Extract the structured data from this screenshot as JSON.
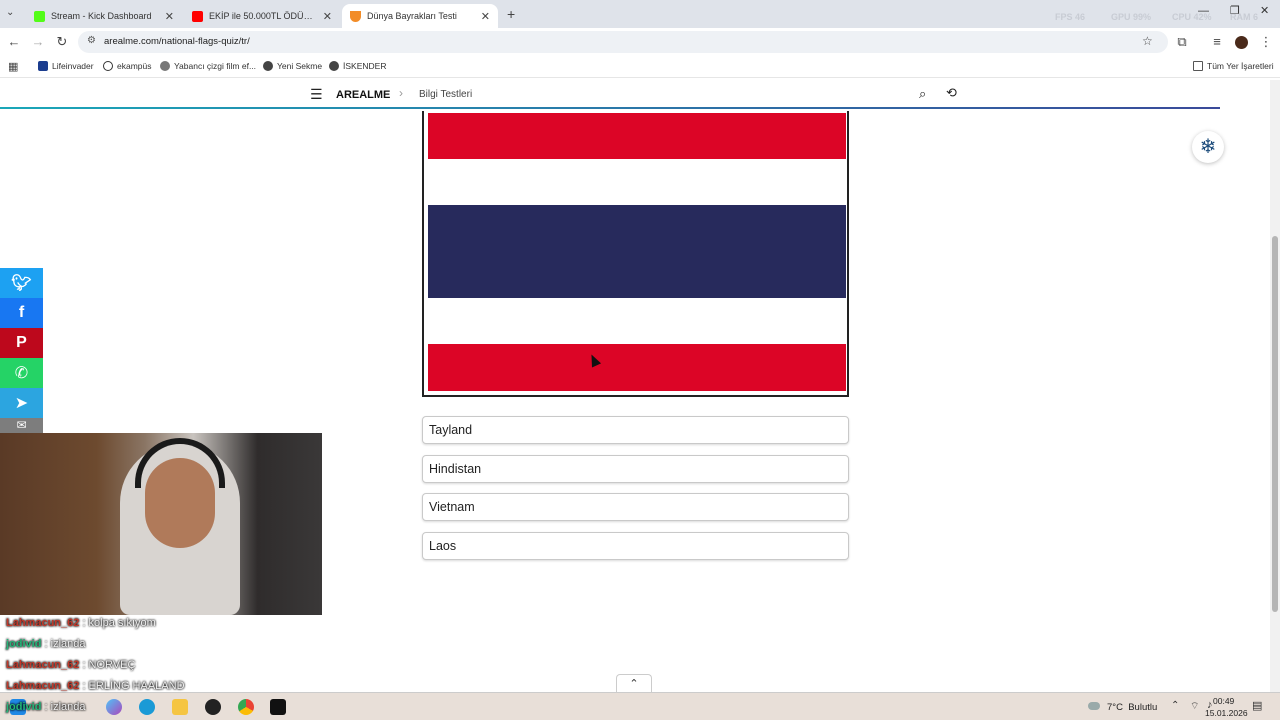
{
  "browser": {
    "tabs": [
      {
        "title": "Stream - Kick Dashboard",
        "favicon_color": "#53fc18"
      },
      {
        "title": "EKİP ile 50.000TL ÖDÜLLÜ MM...",
        "favicon_color": "#ff0000"
      },
      {
        "title": "Dünya Bayrakları Testi",
        "favicon_color": "#f28c28"
      }
    ],
    "new_tab_label": "+",
    "url": "arealme.com/national-flags-quiz/tr/",
    "perf": {
      "fps": "FPS 46",
      "gpu": "GPU 99%",
      "cpu": "CPU 42%",
      "ram": "RAM 6"
    }
  },
  "bookmarks": {
    "items": [
      {
        "label": "Lifeinvader"
      },
      {
        "label": "ekampüs"
      },
      {
        "label": "Yabancı çizgi film ef..."
      },
      {
        "label": "Yeni Sekme"
      },
      {
        "label": "İSKENDER"
      }
    ],
    "all_bookmarks": "Tüm Yer İşaretleri"
  },
  "site": {
    "brand": "AREALME",
    "breadcrumb": "Bilgi Testleri"
  },
  "quiz": {
    "flag_colors": {
      "red": "#dc0526",
      "white": "#ffffff",
      "blue": "#272a5c"
    },
    "answers": [
      "Tayland",
      "Hindistan",
      "Vietnam",
      "Laos"
    ]
  },
  "social": {
    "buttons": [
      {
        "name": "twitter",
        "color": "#1da1f2"
      },
      {
        "name": "facebook",
        "color": "#1877f2"
      },
      {
        "name": "pinterest",
        "color": "#bd081c"
      },
      {
        "name": "whatsapp",
        "color": "#25d366"
      },
      {
        "name": "telegram",
        "color": "#2ca5e0"
      },
      {
        "name": "email",
        "color": "#7d7d7d"
      }
    ]
  },
  "chat": {
    "messages": [
      {
        "user": "Lahmacun_62",
        "text": ": kolpa sıkıyom"
      },
      {
        "user": "jodivid",
        "text": ": izlanda"
      },
      {
        "user": "Lahmacun_62",
        "text": ": NORVEÇ"
      },
      {
        "user": "Lahmacun_62",
        "text": ": ERLİNG HAALAND"
      },
      {
        "user": "jodivid",
        "text": ": izlanda"
      }
    ]
  },
  "taskbar": {
    "weather": "7°C  Bulutlu",
    "time": "00:49",
    "date": "15.01.2026"
  }
}
